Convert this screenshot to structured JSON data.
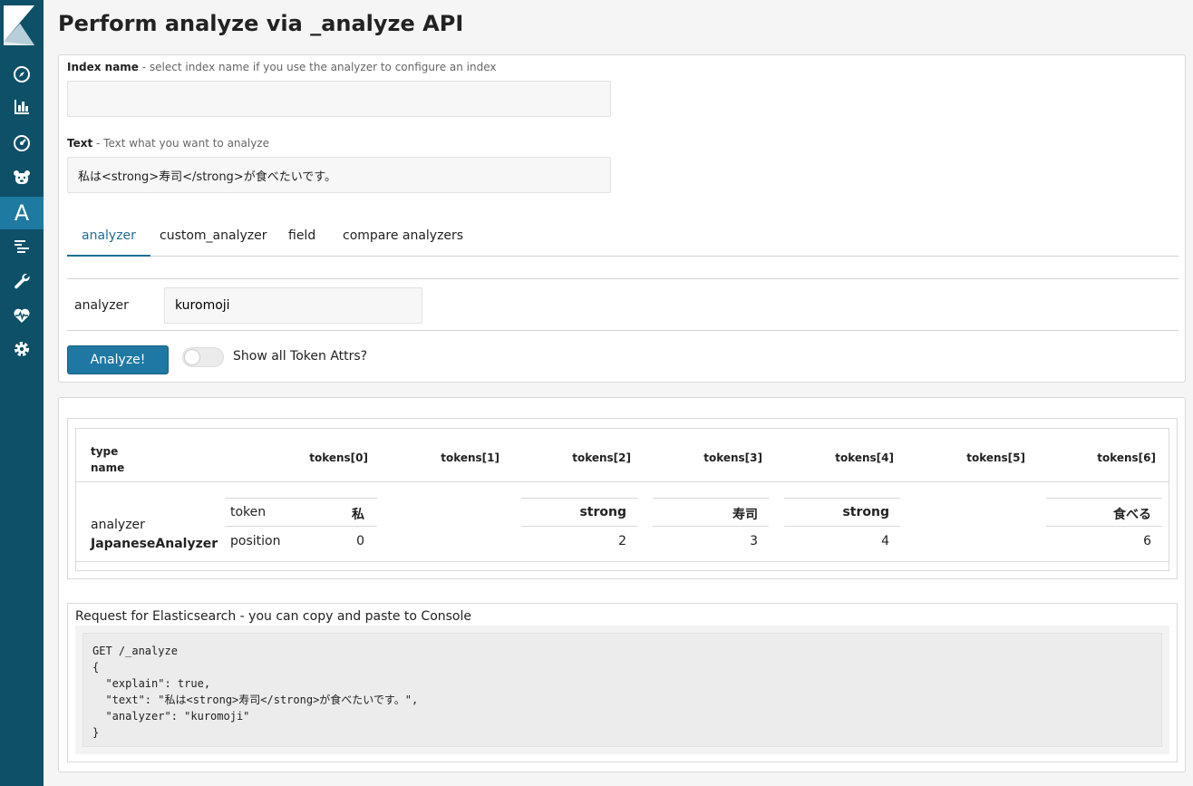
{
  "sidebar": {
    "items": [
      {
        "icon": "compass-icon"
      },
      {
        "icon": "bar-chart-icon"
      },
      {
        "icon": "gauge-icon"
      },
      {
        "icon": "bear-icon"
      },
      {
        "icon": "analyzer-a-icon",
        "glyph": "A",
        "active": true
      },
      {
        "icon": "list-icon"
      },
      {
        "icon": "wrench-icon"
      },
      {
        "icon": "heartbeat-icon"
      },
      {
        "icon": "gear-icon"
      }
    ],
    "accent": "#1e7aa0",
    "background": "#0d5068"
  },
  "page": {
    "title": "Perform analyze via _analyze API"
  },
  "form": {
    "index_label": "Index name",
    "index_hint": " - select index name if you use the analyzer to configure an index",
    "index_value": "",
    "text_label": "Text",
    "text_hint": " - Text what you want to analyze",
    "text_value": "私は<strong>寿司</strong>が食べたいです。"
  },
  "tabs": [
    {
      "label": "analyzer",
      "active": true
    },
    {
      "label": "custom_analyzer",
      "active": false
    },
    {
      "label": "field",
      "active": false
    },
    {
      "label": "compare analyzers",
      "active": false
    }
  ],
  "analyzer": {
    "label": "analyzer",
    "value": "kuromoji"
  },
  "actions": {
    "analyze_label": "Analyze!",
    "toggle_label": "Show all Token Attrs?",
    "toggle_on": false,
    "button_color": "#1e78a3"
  },
  "results": {
    "head_type": "type",
    "head_name": "name",
    "token_headers": [
      "tokens[0]",
      "tokens[1]",
      "tokens[2]",
      "tokens[3]",
      "tokens[4]",
      "tokens[5]",
      "tokens[6]"
    ],
    "row_type": "analyzer",
    "row_name": "JapaneseAnalyzer",
    "attr_token": "token",
    "attr_position": "position",
    "tokens": [
      {
        "token": "私",
        "position": "0"
      },
      null,
      {
        "token": "strong",
        "position": "2"
      },
      {
        "token": "寿司",
        "position": "3"
      },
      {
        "token": "strong",
        "position": "4"
      },
      null,
      {
        "token": "食べる",
        "position": "6"
      }
    ]
  },
  "request": {
    "title": "Request for Elasticsearch - you can copy and paste to Console",
    "code": "GET /_analyze\n{\n  \"explain\": true,\n  \"text\": \"私は<strong>寿司</strong>が食べたいです。\",\n  \"analyzer\": \"kuromoji\"\n}"
  }
}
